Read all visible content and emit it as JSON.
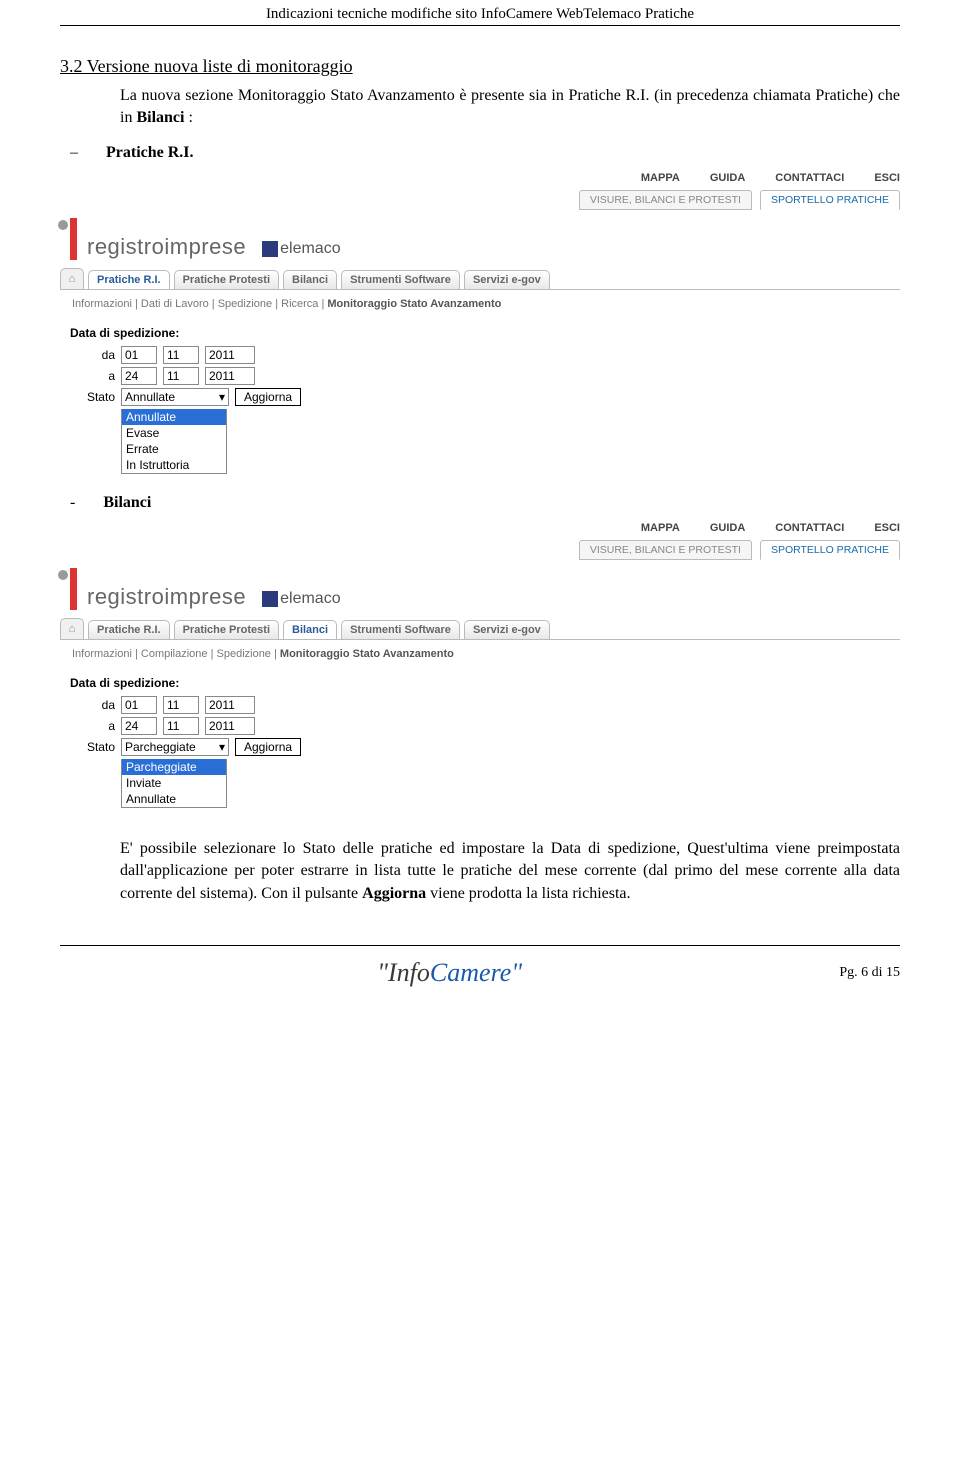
{
  "doc": {
    "header": "Indicazioni tecniche modifiche sito InfoCamere WebTelemaco Pratiche",
    "section_title": "3.2 Versione nuova liste di monitoraggio",
    "para1_a": "La nuova sezione Monitoraggio Stato Avanzamento è presente sia in Pratiche R.I. (in precedenza chiamata Pratiche) che in ",
    "para1_b": "Bilanci",
    "para1_c": " :",
    "item_a_dash": "–",
    "item_a_label": "Pratiche R.I.",
    "item_b_dash": "-",
    "item_b_label": "Bilanci",
    "bottom_a": "E' possibile selezionare lo Stato delle pratiche ed impostare la Data di spedizione, Quest'ultima viene preimpostata dall'applicazione per poter estrarre in lista tutte le pratiche del mese corrente (dal primo del mese corrente alla data corrente del sistema). Con il pulsante ",
    "bottom_b": "Aggiorna",
    "bottom_c": " viene prodotta la lista richiesta.",
    "footer_pre": "\"Info",
    "footer_mid": "Camere\"",
    "page_num": "Pg. 6 di 15"
  },
  "topnav": [
    "MAPPA",
    "GUIDA",
    "CONTATTACI",
    "ESCI"
  ],
  "sectabs": {
    "a": "VISURE, BILANCI E PROTESTI",
    "b": "SPORTELLO PRATICHE"
  },
  "logo_text": "registroimprese",
  "telemaco": "elemaco",
  "tabs": [
    "Pratiche R.I.",
    "Pratiche Protesti",
    "Bilanci",
    "Strumenti Software",
    "Servizi e-gov"
  ],
  "shot_a": {
    "crumbs": "Informazioni | Dati di Lavoro | Spedizione | Ricerca | ",
    "crumbs_strong": "Monitoraggio Stato Avanzamento",
    "form_title": "Data di spedizione:",
    "da": "da",
    "a": "a",
    "stato": "Stato",
    "d1": "01",
    "m1": "11",
    "y1": "2011",
    "d2": "24",
    "m2": "11",
    "y2": "2011",
    "sel": "Annullate",
    "btn": "Aggiorna",
    "opts": [
      "Annullate",
      "Evase",
      "Errate",
      "In Istruttoria"
    ]
  },
  "shot_b": {
    "crumbs": "Informazioni | Compilazione | Spedizione | ",
    "crumbs_strong": "Monitoraggio Stato Avanzamento",
    "form_title": "Data di spedizione:",
    "da": "da",
    "a": "a",
    "stato": "Stato",
    "d1": "01",
    "m1": "11",
    "y1": "2011",
    "d2": "24",
    "m2": "11",
    "y2": "2011",
    "sel": "Parcheggiate",
    "btn": "Aggiorna",
    "opts": [
      "Parcheggiate",
      "Inviate",
      "Annullate"
    ]
  }
}
